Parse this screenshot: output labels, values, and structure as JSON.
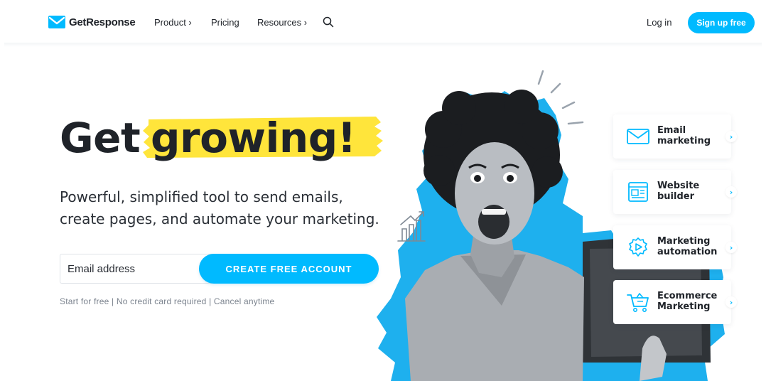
{
  "nav": {
    "brand": "GetResponse",
    "items": [
      {
        "label": "Product ›"
      },
      {
        "label": "Pricing"
      },
      {
        "label": "Resources ›"
      }
    ],
    "login": "Log in",
    "signup": "Sign up free"
  },
  "hero": {
    "headline_word1": "Get",
    "headline_word2": "growing!",
    "subhead_line1": "Powerful, simplified tool to send emails,",
    "subhead_line2": "create pages, and automate your marketing.",
    "email_placeholder": "Email address",
    "cta": "CREATE FREE ACCOUNT",
    "note": "Start for free | No credit card required | Cancel anytime"
  },
  "features": [
    {
      "line1": "Email",
      "line2": "marketing",
      "icon": "envelope-icon"
    },
    {
      "line1": "Website",
      "line2": "builder",
      "icon": "website-icon"
    },
    {
      "line1": "Marketing",
      "line2": "automation",
      "icon": "automation-gear-icon"
    },
    {
      "line1": "Ecommerce",
      "line2": "Marketing",
      "icon": "cart-icon"
    }
  ],
  "colors": {
    "accent": "#00baff",
    "highlight": "#ffe53b",
    "text": "#1f2329",
    "muted": "#7b838e"
  }
}
